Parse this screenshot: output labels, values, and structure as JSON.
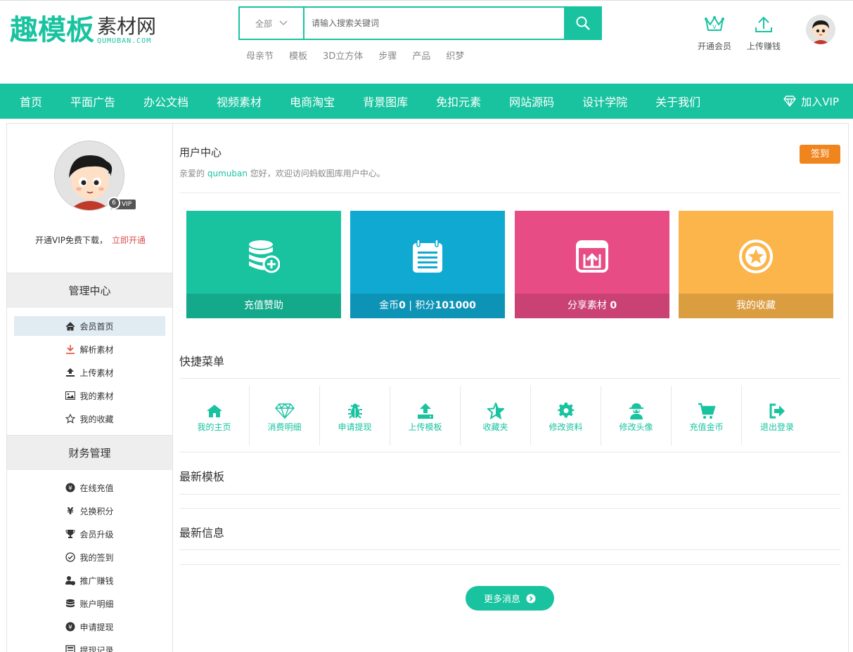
{
  "header": {
    "logo_main": "趣模板",
    "logo_sub": "素材网",
    "logo_en": "QUMUBAN.COM",
    "search_category": "全部",
    "search_placeholder": "请输入搜索关键词",
    "hot_words": [
      "母亲节",
      "模板",
      "3D立方体",
      "步骤",
      "产品",
      "织梦"
    ],
    "open_member": "开通会员",
    "upload_earn": "上传赚钱"
  },
  "nav": {
    "items": [
      "首页",
      "平面广告",
      "办公文档",
      "视频素材",
      "电商淘宝",
      "背景图库",
      "免扣元素",
      "网站源码",
      "设计学院",
      "关于我们"
    ],
    "join_vip": "加入VIP"
  },
  "sidebar": {
    "vip_level": "6",
    "vip_label": "VIP",
    "tip_text": "开通VIP免费下载，",
    "tip_link": "立即开通",
    "section1": "管理中心",
    "section1_items": [
      {
        "label": "会员首页",
        "icon": "home-icon"
      },
      {
        "label": "解析素材",
        "icon": "download-icon"
      },
      {
        "label": "上传素材",
        "icon": "upload-icon"
      },
      {
        "label": "我的素材",
        "icon": "image-icon"
      },
      {
        "label": "我的收藏",
        "icon": "star-icon"
      }
    ],
    "section2": "财务管理",
    "section2_items": [
      {
        "label": "在线充值",
        "icon": "yen-icon"
      },
      {
        "label": "兑换积分",
        "icon": "exchange-icon"
      },
      {
        "label": "会员升级",
        "icon": "trophy-icon"
      },
      {
        "label": "我的签到",
        "icon": "check-circle-icon"
      },
      {
        "label": "推广赚钱",
        "icon": "user-money-icon"
      },
      {
        "label": "账户明细",
        "icon": "database-icon"
      },
      {
        "label": "申请提现",
        "icon": "yen-icon"
      },
      {
        "label": "提现记录",
        "icon": "list-icon"
      }
    ]
  },
  "main": {
    "title": "用户中心",
    "welcome_pre": "亲爱的",
    "username": "qumuban",
    "welcome_post": "您好，欢迎访问蚂蚁图库用户中心。",
    "sign_in": "签到",
    "cards": [
      {
        "label": "充值赞助",
        "color": "#19c3a0",
        "icon": "coins-icon"
      },
      {
        "label_pre": "金币",
        "coins": "0",
        "sep": " | 积分",
        "points": "101000",
        "color": "#0fa9d2",
        "icon": "notepad-icon"
      },
      {
        "label_pre": "分享素材",
        "count": "0",
        "color": "#e74c85",
        "icon": "share-upload-icon"
      },
      {
        "label": "我的收藏",
        "color": "#fbb54a",
        "icon": "star-circle-icon"
      }
    ],
    "quick_title": "快捷菜单",
    "quick_items": [
      {
        "label": "我的主页",
        "icon": "home-icon"
      },
      {
        "label": "消费明细",
        "icon": "diamond-icon"
      },
      {
        "label": "申请提现",
        "icon": "bug-icon"
      },
      {
        "label": "上传模板",
        "icon": "upload-icon"
      },
      {
        "label": "收藏夹",
        "icon": "star-icon"
      },
      {
        "label": "修改资料",
        "icon": "gear-icon"
      },
      {
        "label": "修改头像",
        "icon": "user-secret-icon"
      },
      {
        "label": "充值金币",
        "icon": "cart-icon"
      },
      {
        "label": "退出登录",
        "icon": "logout-icon"
      }
    ],
    "latest_templates": "最新模板",
    "latest_info": "最新信息",
    "more": "更多消息"
  },
  "colors": {
    "accent": "#19c3a0",
    "orange": "#f0851d",
    "blue": "#0fa9d2",
    "pink": "#e74c85",
    "yellow": "#fbb54a"
  }
}
